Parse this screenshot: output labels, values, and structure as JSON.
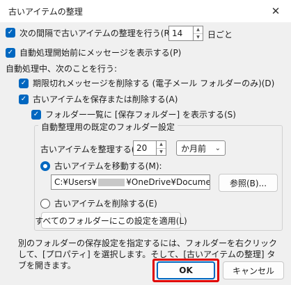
{
  "window": {
    "title": "古いアイテムの整理",
    "close_glyph": "✕"
  },
  "main": {
    "check1_label": "次の間隔で古いアイテムの整理を行う(R):",
    "interval_value": "14",
    "interval_unit": "日ごと",
    "check2_label": "自動処理開始前にメッセージを表示する(P)",
    "section_label": "自動処理中、次のことを行う:",
    "check3_label": "期限切れメッセージを削除する (電子メール フォルダーのみ)(D)",
    "check4_label": "古いアイテムを保存または削除する(A)",
    "check5_label": "フォルダー一覧に [保存フォルダー] を表示する(S)"
  },
  "group": {
    "title": "自動整理用の既定のフォルダー設定",
    "older_label": "古いアイテムを整理する(C)",
    "older_value": "20",
    "period_value": "か月前",
    "radio_move_label": "古いアイテムを移動する(M):",
    "path_prefix": "C:¥Users¥",
    "path_suffix": "¥OneDrive¥Documer",
    "browse_button": "参照(B)...",
    "radio_delete_label": "古いアイテムを削除する(E)",
    "apply_all_button": "すべてのフォルダーにこの設定を適用(L)"
  },
  "footer": {
    "info_text": "別のフォルダーの保存設定を指定するには、フォルダーを右クリックして、[プロパティ] を選択します。そして、[古いアイテムの整理] タブを開きます。",
    "ok_button": "OK",
    "cancel_button": "キャンセル"
  },
  "colors": {
    "accent": "#0067c0",
    "highlight": "#e00000"
  },
  "icons": {
    "check": "checkmark-icon",
    "close": "close-icon",
    "chevron": "chevron-down-icon"
  }
}
